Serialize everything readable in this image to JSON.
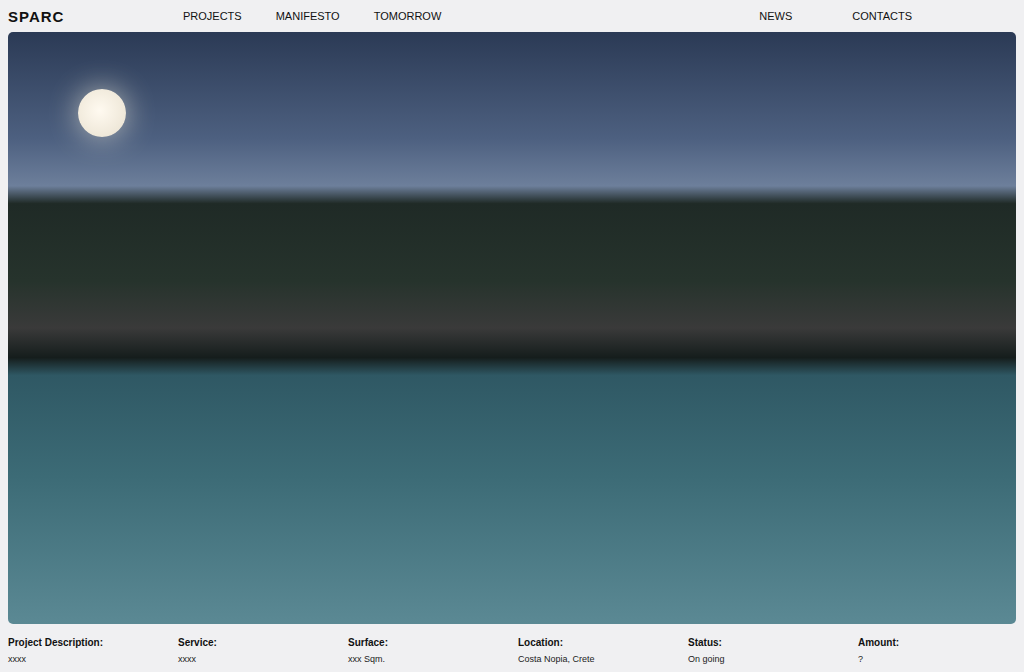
{
  "logo": "SPARC",
  "nav": {
    "left": [
      {
        "label": "PROJECTS"
      },
      {
        "label": "MANIFESTO"
      },
      {
        "label": "TOMORROW"
      }
    ],
    "right": [
      {
        "label": "NEWS"
      },
      {
        "label": "CONTACTS"
      }
    ]
  },
  "details": [
    {
      "label": "Project Description:",
      "value": "xxxx"
    },
    {
      "label": "Service:",
      "value": "xxxx"
    },
    {
      "label": "Surface:",
      "value": "xxx Sqm."
    },
    {
      "label": "Location:",
      "value": "Costa Nopia, Crete"
    },
    {
      "label": "Status:",
      "value": "On going"
    },
    {
      "label": "Amount:",
      "value": "?"
    }
  ]
}
